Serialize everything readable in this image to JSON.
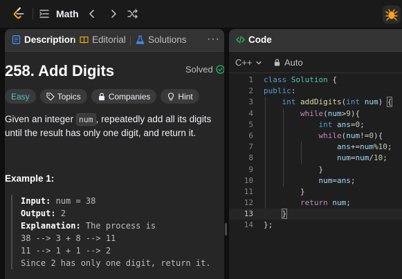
{
  "topbar": {
    "problem_list_label": "Math",
    "icons": [
      "leetcode-logo",
      "list-icon",
      "chevron-left-icon",
      "chevron-right-icon",
      "shuffle-icon",
      "debug-icon"
    ],
    "accent": "#ffa116"
  },
  "left_panel": {
    "tabs": [
      {
        "label": "Description",
        "icon": "description-icon",
        "color": "#3e8ef7"
      },
      {
        "label": "Editorial",
        "icon": "book-icon",
        "color": "#ffb800"
      },
      {
        "label": "Solutions",
        "icon": "flask-icon",
        "color": "#3e8ef7"
      }
    ],
    "more_label": "···",
    "title": "258. Add Digits",
    "solved_label": "Solved",
    "solved_color": "#2cbb5d",
    "chips": {
      "difficulty": "Easy",
      "topics": "Topics",
      "companies": "Companies",
      "hint": "Hint"
    },
    "difficulty_color": "#46c6c2",
    "description": {
      "part1": "Given an integer ",
      "code": "num",
      "part2": ", repeatedly add all its digits until the result has only one digit, and return it."
    },
    "example": {
      "title": "Example 1:",
      "input_label": "Input:",
      "input_value": " num = 38",
      "output_label": "Output:",
      "output_value": " 2",
      "explanation_label": "Explanation:",
      "explanation_value": " The process is",
      "lines": [
        "38 --> 3 + 8 --> 11",
        "11 --> 1 + 1 --> 2",
        "Since 2 has only one digit, return it."
      ]
    }
  },
  "right_panel": {
    "tab_label": "Code",
    "tab_icon_color": "#2cbb5d",
    "language": "C++",
    "mode": "Auto",
    "active_line": 13,
    "line_numbers": [
      "1",
      "2",
      "3",
      "4",
      "5",
      "6",
      "7",
      "8",
      "9",
      "10",
      "11",
      "12",
      "13",
      "14"
    ]
  }
}
